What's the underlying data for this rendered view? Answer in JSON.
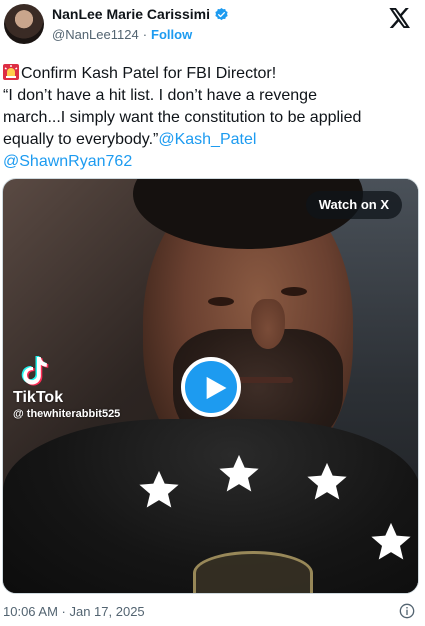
{
  "author": {
    "display_name": "NanLee Marie Carissimi",
    "handle": "@NanLee1124",
    "separator": "·",
    "follow_label": "Follow"
  },
  "tweet": {
    "line1": "Confirm Kash Patel for FBI Director!",
    "line2": "“I don’t have a hit list. I don’t have a revenge",
    "line3": "march...I simply want the constitution to be applied",
    "line4_text": "equally to everybody.”",
    "mention1": "@Kash_Patel",
    "mention2": "@ShawnRyan762",
    "timestamp": "10:06 AM · Jan 17, 2025"
  },
  "media": {
    "watch_label": "Watch on X",
    "watermark_brand": "TikTok",
    "watermark_handle": "@ thewhiterabbit525"
  },
  "icons": {
    "verified": "verified-badge-icon",
    "x_logo": "x-logo-icon",
    "siren": "siren-emoji-icon",
    "play": "play-icon",
    "info": "info-icon"
  },
  "colors": {
    "accent": "#1d9bf0",
    "text": "#0f1419",
    "muted": "#536471"
  }
}
